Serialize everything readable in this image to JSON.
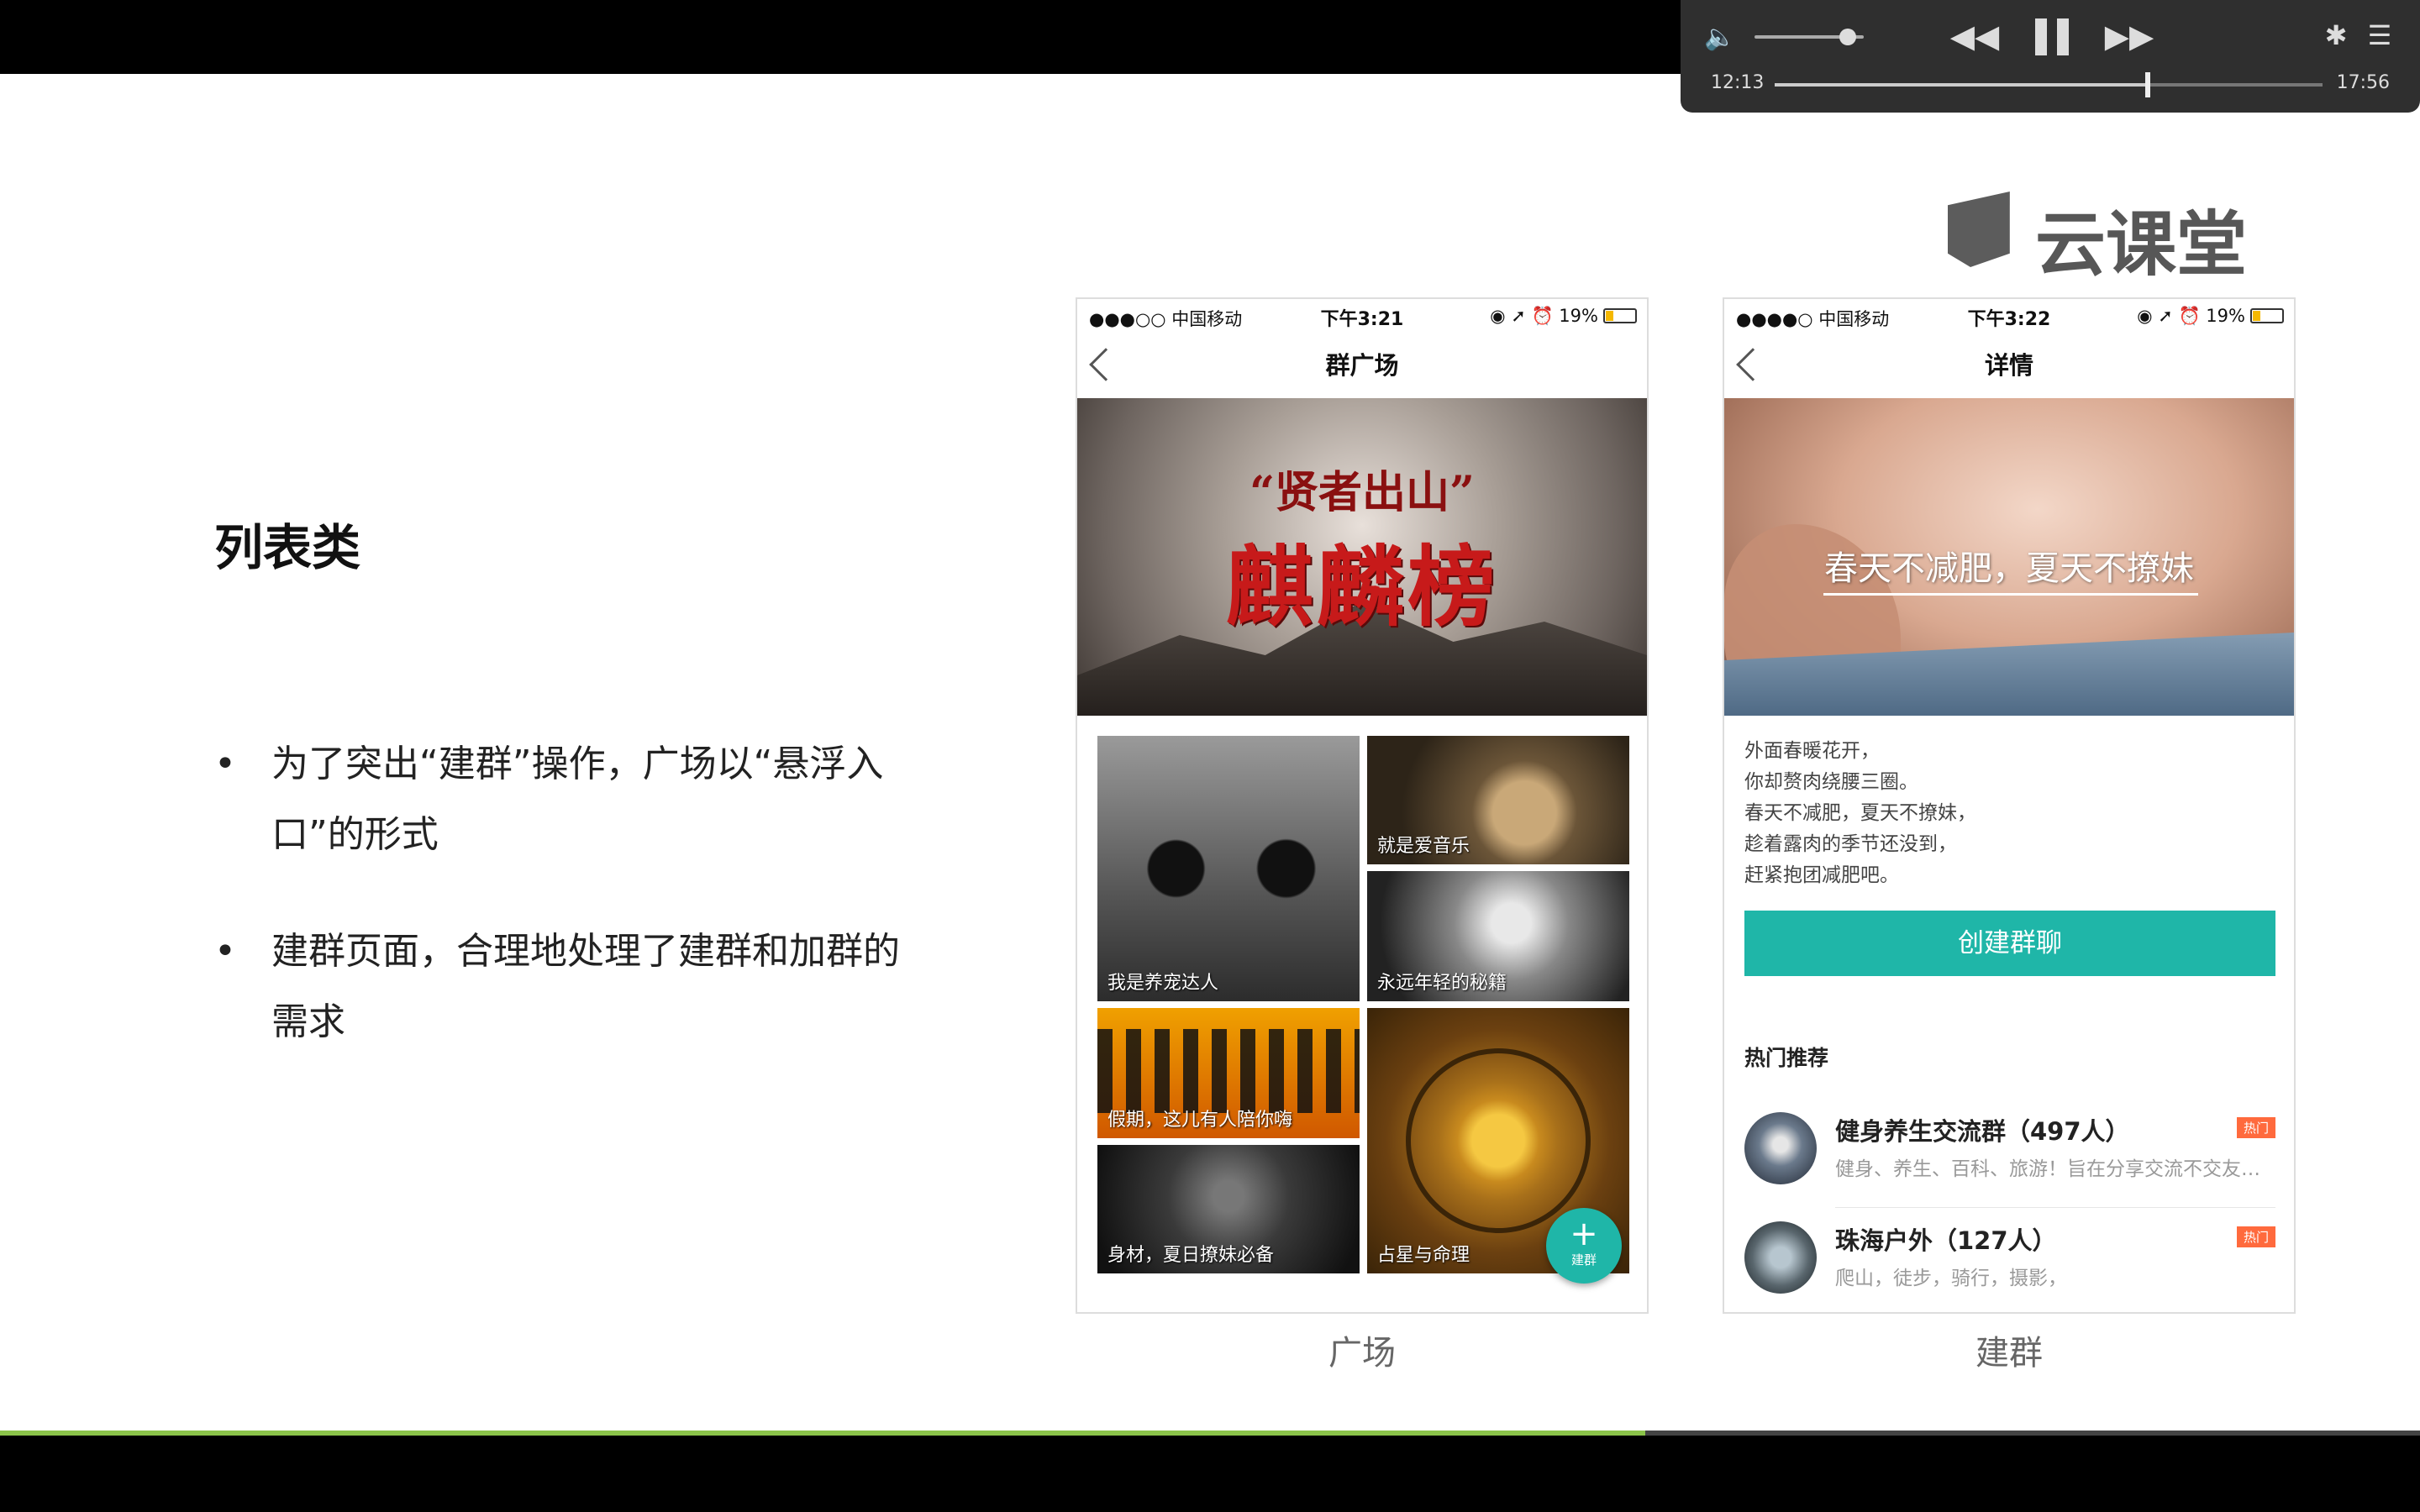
{
  "slide": {
    "title": "列表类",
    "bullets": [
      {
        "dot": "•",
        "text": "为了突出“建群”操作，广场以“悬浮入口”的形式"
      },
      {
        "dot": "•",
        "text": "建群页面，合理地处理了建群和加群的需求"
      }
    ]
  },
  "phone1": {
    "status": {
      "carrier": "●●●○○ 中国移动",
      "time": "下午3:21",
      "right": "◉ ➚ ⏰ 19%"
    },
    "nav_title": "群广场",
    "banner": {
      "sub": "“贤者出山”",
      "main": "麒麟榜"
    },
    "tiles": {
      "cat": "我是养宠达人",
      "music": "就是爱音乐",
      "youth": "永远年轻的秘籍",
      "party": "假期，这儿有人陪你嗨",
      "fitness": "身材，夏日撩妹必备",
      "astro": "占星与命理"
    },
    "fab": {
      "plus": "+",
      "label": "建群"
    },
    "caption": "广场"
  },
  "phone2": {
    "status": {
      "carrier": "●●●●○ 中国移动",
      "time": "下午3:22",
      "right": "◉ ➚ ⏰ 19%"
    },
    "nav_title": "详情",
    "banner_text": "春天不减肥，夏天不撩妹",
    "description": [
      "外面春暖花开，",
      "你却赘肉绕腰三圈。",
      "春天不减肥，夏天不撩妹，",
      "趁着露肉的季节还没到，",
      "赶紧抱团减肥吧。"
    ],
    "create_button": "创建群聊",
    "hot_title": "热门推荐",
    "groups": [
      {
        "name": "健身养生交流群（497人）",
        "desc": "健身、养生、百科、旅游！旨在分享交流不交友…",
        "badge": "热门"
      },
      {
        "name": "珠海户外（127人）",
        "desc": "爬山，徒步，骑行，摄影，",
        "badge": "热门"
      }
    ],
    "caption": "建群"
  },
  "watermark": {
    "text": "云课堂"
  },
  "player": {
    "time_current": "12:13",
    "time_total": "17:56",
    "volume_fraction": 0.85,
    "seek_fraction": 0.681,
    "icons": {
      "volume": "🔈",
      "rewind": "◀◀",
      "forward": "▶▶",
      "settings": "✱",
      "menu": "☰"
    }
  },
  "lesson_progress_fraction": 0.68,
  "colors": {
    "accent": "#1fb6a8",
    "hot_badge": "#ff6a3d",
    "progress": "#8bc34a",
    "banner_red": "#c71a1a"
  }
}
